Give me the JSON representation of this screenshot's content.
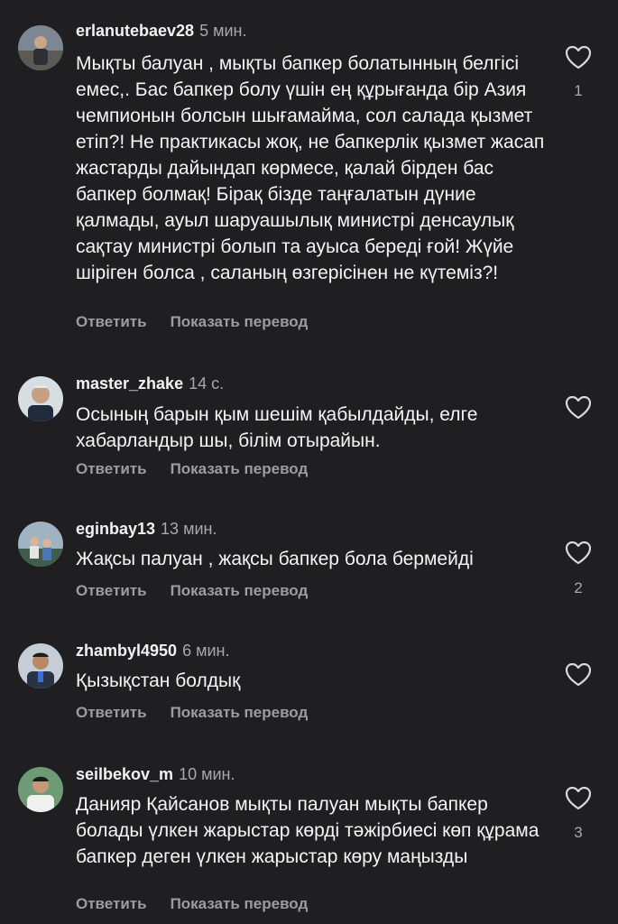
{
  "actions": {
    "reply_label": "Ответить",
    "translate_label": "Показать перевод"
  },
  "comments": [
    {
      "username": "erlanutebaev28",
      "time": "5 мин.",
      "text": "Мықты балуан , мықты бапкер болатынның белгісі емес,. Бас бапкер болу үшін ең құрығанда бір Азия чемпионын болсын шығамайма, сол салада қызмет етіп?! Не практикасы жоқ, не бапкерлік қызмет жасап жастарды дайындап көрмесе, қалай бірден бас бапкер болмақ! Бірақ бізде таңғалатын дүние қалмады, ауыл шаруашылық министрі денсаулық сақтау министрі болып та ауыса береді ғой! Жүйе шіріген болса , саланың өзгерісінен не күтеміз?!",
      "likes": "1"
    },
    {
      "username": "master_zhake",
      "time": "14 с.",
      "text": "Осының барын қым шешім қабылдайды, елге хабарландыр шы, білім отырайын.",
      "likes": ""
    },
    {
      "username": "eginbay13",
      "time": "13 мин.",
      "text": "Жақсы палуан , жақсы бапкер бола бермейді",
      "likes": "2"
    },
    {
      "username": "zhambyl4950",
      "time": "6 мин.",
      "text": "Қызықстан болдық",
      "likes": ""
    },
    {
      "username": "seilbekov_m",
      "time": "10 мин.",
      "text": "Данияр Қайсанов мықты палуан мықты бапкер болады үлкен жарыстар көрді  тәжірбиесі көп құрама бапкер деген  үлкен жарыстар көру маңызды",
      "likes": "3"
    }
  ]
}
